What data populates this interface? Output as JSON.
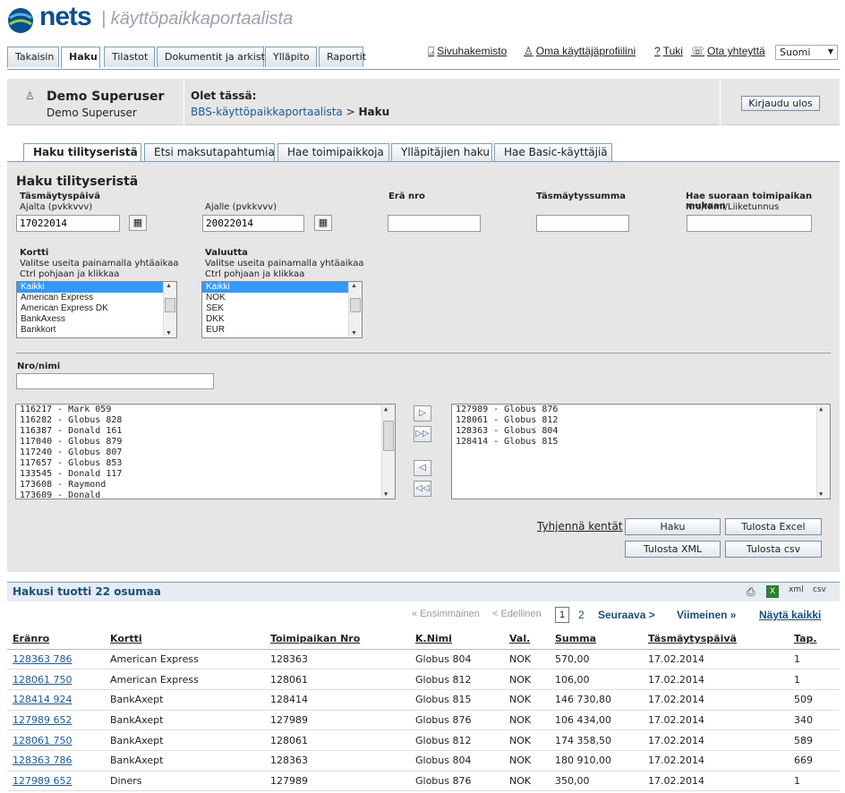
{
  "brand": {
    "name": "nets",
    "portal": "| käyttöpaikkaportaalista"
  },
  "main_tabs": [
    "Takaisin",
    "Haku",
    "Tilastot",
    "Dokumentit ja arkisto",
    "Ylläpito",
    "Raportit"
  ],
  "topnav": [
    {
      "icon": "sitemap-icon",
      "label": "Sivuhakemisto"
    },
    {
      "icon": "user-icon",
      "label": "Oma käyttäjäprofiilini"
    },
    {
      "icon": "help-icon",
      "label": "Tuki"
    },
    {
      "icon": "phone-icon",
      "label": "Ota yhteyttä"
    }
  ],
  "language": "Suomi",
  "user": {
    "name": "Demo Superuser",
    "role": "Demo Superuser"
  },
  "location": {
    "label": "Olet tässä:",
    "link": "BBS-käyttöpaikkaportaalista",
    "sep": ">",
    "current": "Haku"
  },
  "logout": "Kirjaudu ulos",
  "sub_tabs": [
    "Haku tilityseristä",
    "Etsi maksutapahtumia",
    "Hae toimipaikkoja",
    "Ylläpitäjien haku",
    "Hae Basic-käyttäjiä"
  ],
  "form": {
    "title": "Haku tilityseristä",
    "date_label": "Täsmäytyspäivä",
    "from_label": "Ajalta (pvkkvvv)",
    "from_value": "17022014",
    "to_label": "Ajalle (pvkkvvv)",
    "to_value": "20022014",
    "batch_label": "Erä nro",
    "amount_label": "Täsmäytyssumma",
    "direct_label": "Hae suoraan toimipaikan mukaan",
    "direct_sub": "Nro/Nimi/Liiketunnus",
    "card_label": "Kortti",
    "multi_hint1": "Valitse useita painamalla yhtäaikaa",
    "multi_hint2": "Ctrl pohjaan ja klikkaa",
    "currency_label": "Valuutta",
    "cards": [
      "Kaikki",
      "American Express",
      "American Express DK",
      "BankAxess",
      "Bankkort"
    ],
    "currencies": [
      "Kaikki",
      "NOK",
      "SEK",
      "DKK",
      "EUR"
    ],
    "nro_label": "Nro/nimi",
    "available": [
      "116217 - Mark 059",
      "116282 - Globus 828",
      "116387 - Donald 161",
      "117040 - Globus 879",
      "117240 - Globus 807",
      "117657 - Globus 853",
      "133545 - Donald 117",
      "173608 - Raymond",
      "173609 - Donald"
    ],
    "selected": [
      "127989 - Globus 876",
      "128061 - Globus 812",
      "128363 - Globus 804",
      "128414 - Globus 815"
    ],
    "clear": "Tyhjennä kentät",
    "search": "Haku",
    "print_excel": "Tulosta Excel",
    "print_xml": "Tulosta XML",
    "print_csv": "Tulosta csv"
  },
  "results": {
    "count_text": "Hakusi tuotti 22 osumaa",
    "xml": "xml",
    "csv": "csv"
  },
  "pager": {
    "first": "« Ensimmäinen",
    "prev": "< Edellinen",
    "current": "1",
    "page2": "2",
    "next": "Seuraava >",
    "last": "Viimeinen »",
    "all": "Näytä kaikki"
  },
  "table": {
    "headers": [
      "Eränro",
      "Kortti",
      "Toimipaikan Nro",
      "K.Nimi",
      "Val.",
      "Summa",
      "Täsmäytyspäivä",
      "Tap."
    ],
    "rows": [
      [
        "128363 786",
        "American Express",
        "128363",
        "Globus 804",
        "NOK",
        "570,00",
        "17.02.2014",
        "1"
      ],
      [
        "128061 750",
        "American Express",
        "128061",
        "Globus 812",
        "NOK",
        "106,00",
        "17.02.2014",
        "1"
      ],
      [
        "128414 924",
        "BankAxept",
        "128414",
        "Globus 815",
        "NOK",
        "146 730,80",
        "17.02.2014",
        "509"
      ],
      [
        "127989 652",
        "BankAxept",
        "127989",
        "Globus 876",
        "NOK",
        "106 434,00",
        "17.02.2014",
        "340"
      ],
      [
        "128061 750",
        "BankAxept",
        "128061",
        "Globus 812",
        "NOK",
        "174 358,50",
        "17.02.2014",
        "589"
      ],
      [
        "128363 786",
        "BankAxept",
        "128363",
        "Globus 804",
        "NOK",
        "180 910,00",
        "17.02.2014",
        "669"
      ],
      [
        "127989 652",
        "Diners",
        "127989",
        "Globus 876",
        "NOK",
        "350,00",
        "17.02.2014",
        "1"
      ]
    ]
  }
}
